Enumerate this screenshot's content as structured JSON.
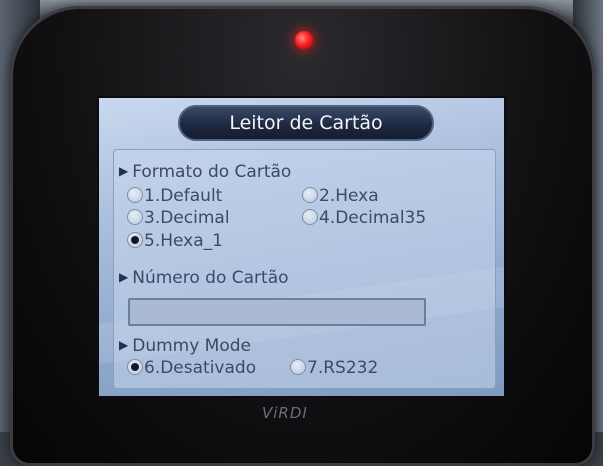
{
  "screen": {
    "title": "Leitor de Cartão",
    "sections": {
      "format": {
        "header": "Formato do Cartão",
        "options": [
          {
            "label": "1.Default",
            "selected": false
          },
          {
            "label": "2.Hexa",
            "selected": false
          },
          {
            "label": "3.Decimal",
            "selected": false
          },
          {
            "label": "4.Decimal35",
            "selected": false
          },
          {
            "label": "5.Hexa_1",
            "selected": true
          }
        ]
      },
      "card_number": {
        "header": "Número do Cartão",
        "value": ""
      },
      "dummy_mode": {
        "header": "Dummy Mode",
        "options": [
          {
            "label": "6.Desativado",
            "selected": true
          },
          {
            "label": "7.RS232",
            "selected": false
          }
        ]
      }
    }
  },
  "device": {
    "brand": "ViRDI",
    "led_color": "#ff2020"
  },
  "icons": {
    "section_arrow": "triangle-right-icon",
    "radio": "radio-button-icon"
  }
}
